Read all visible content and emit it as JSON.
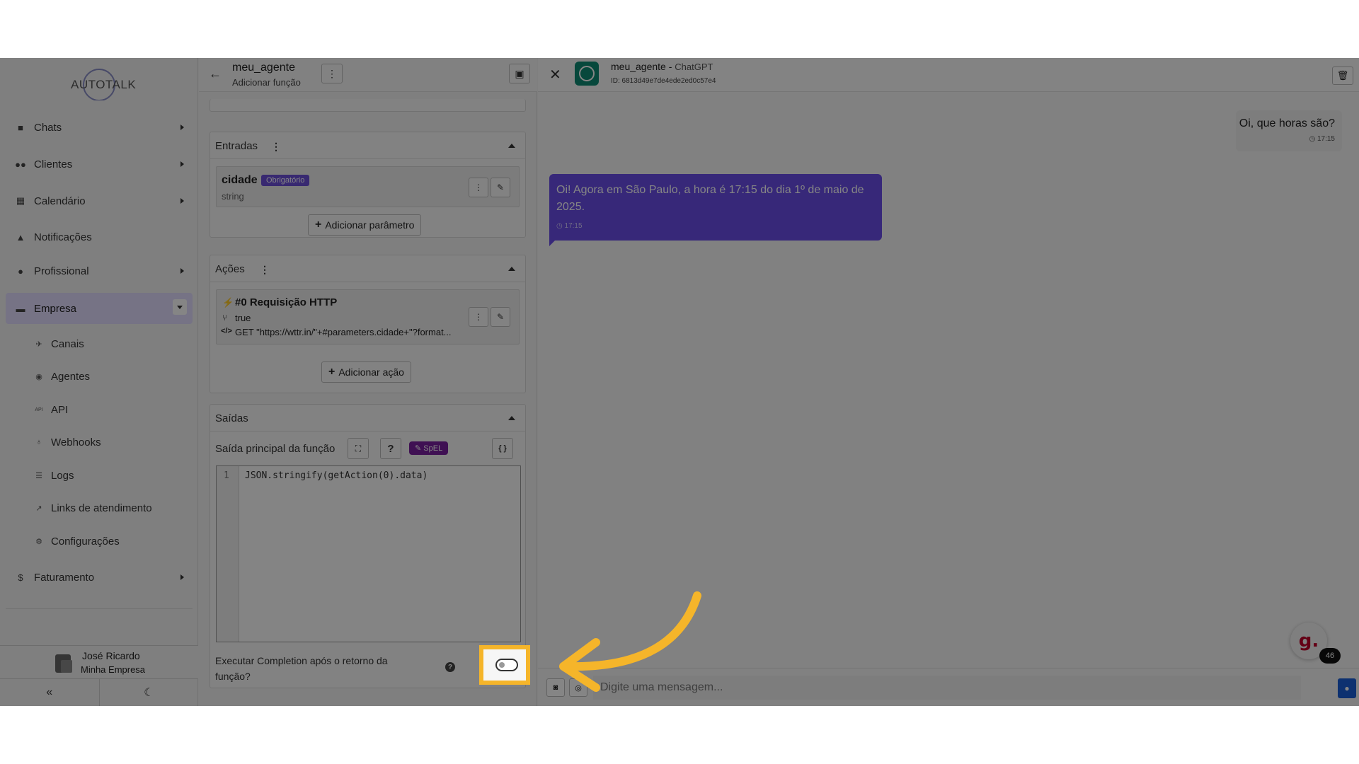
{
  "app": {
    "logo_text": "AUTOTALK"
  },
  "sidebar": {
    "items": [
      {
        "label": "Chats",
        "icon": "chat-bubble-icon"
      },
      {
        "label": "Clientes",
        "icon": "users-icon"
      },
      {
        "label": "Calendário",
        "icon": "calendar-icon"
      },
      {
        "label": "Notificações",
        "icon": "bell-icon"
      },
      {
        "label": "Profissional",
        "icon": "user-tie-icon"
      },
      {
        "label": "Empresa",
        "icon": "building-icon"
      }
    ],
    "subitems": [
      {
        "label": "Canais",
        "icon": "satellite-icon"
      },
      {
        "label": "Agentes",
        "icon": "robot-icon"
      },
      {
        "label": "API",
        "icon": "api-icon"
      },
      {
        "label": "Webhooks",
        "icon": "webhook-icon"
      },
      {
        "label": "Logs",
        "icon": "list-icon"
      },
      {
        "label": "Links de atendimento",
        "icon": "external-link-icon"
      },
      {
        "label": "Configurações",
        "icon": "gear-icon"
      }
    ],
    "billing": {
      "label": "Faturamento",
      "icon": "dollar-icon"
    },
    "user": {
      "name": "José Ricardo",
      "company": "Minha Empresa"
    }
  },
  "editor": {
    "title": "meu_agente",
    "subtitle": "Adicionar função",
    "inputs": {
      "title": "Entradas",
      "param": {
        "name": "cidade",
        "badge": "Obrigatório",
        "type": "string"
      },
      "add_label": "Adicionar parâmetro"
    },
    "actions": {
      "title": "Ações",
      "action": {
        "name": "#0 Requisição HTTP",
        "condition": "true",
        "request": "GET \"https://wttr.in/\"+#parameters.cidade+\"?format..."
      },
      "add_label": "Adicionar ação"
    },
    "outputs": {
      "title": "Saídas",
      "main_label": "Saída principal da função",
      "spel_badge": "SpEL",
      "line_number": "1",
      "code": "JSON.stringify(getAction(0).data)",
      "completion_label": "Executar Completion após o retorno da função?",
      "completion_enabled": false
    }
  },
  "chat": {
    "agent_name": "meu_agente",
    "agent_model": "ChatGPT",
    "agent_id": "ID: 6813d49e7de4ede2ed0c57e4",
    "messages": [
      {
        "from": "user",
        "text": "Oi, que horas são?",
        "time": "17:15"
      },
      {
        "from": "agent",
        "text": "Oi! Agora em São Paulo, a hora é 17:15 do dia 1º de maio de 2025.",
        "time": "17:15"
      }
    ],
    "input_placeholder": "Digite uma mensagem...",
    "widget_letter": "g.",
    "widget_count": "46"
  },
  "colors": {
    "accent": "#6a4de8",
    "highlight": "#f5b52a",
    "mic": "#1a5fd6"
  }
}
